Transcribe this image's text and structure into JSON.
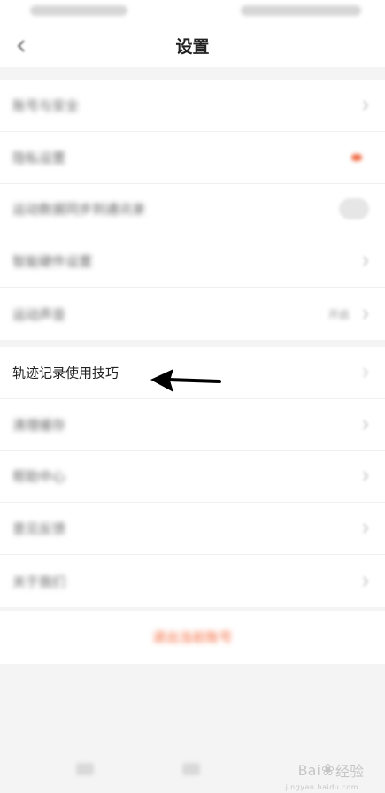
{
  "header": {
    "title": "设置"
  },
  "settings": {
    "group1": [
      {
        "label": "账号与安全",
        "right": "chevron"
      },
      {
        "label": "隐私设置",
        "right": "red-dot"
      },
      {
        "label": "运动数据同步到通讯录",
        "right": "toggle"
      },
      {
        "label": "智能硬件设置",
        "right": "chevron"
      },
      {
        "label": "运动声音",
        "right": "value",
        "value": "开启"
      }
    ],
    "group2": [
      {
        "label": "轨迹记录使用技巧",
        "right": "chevron"
      },
      {
        "label": "清理缓存",
        "right": "chevron"
      },
      {
        "label": "帮助中心",
        "right": "chevron"
      },
      {
        "label": "意见反馈",
        "right": "chevron"
      },
      {
        "label": "关于我们",
        "right": "chevron"
      }
    ]
  },
  "logout": {
    "label": "退出当前账号"
  },
  "watermark": {
    "brand": "Bai",
    "suffix": "经验",
    "sub": "jingyan.baidu.com"
  },
  "colors": {
    "accent": "#f46a3c",
    "background": "#f4f4f5",
    "arrow": "#000000"
  },
  "icons": {
    "back": "back-arrow-icon",
    "chevron": "chevron-right-icon",
    "annotation": "pointer-arrow-icon"
  }
}
